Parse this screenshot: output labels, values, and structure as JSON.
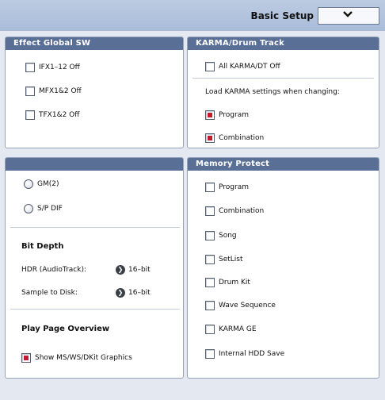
{
  "header": {
    "title": "Basic Setup",
    "dropdown_glyph": "❯"
  },
  "effect_global": {
    "title": "Effect Global SW",
    "items": [
      {
        "label": "IFX1–12 Off",
        "checked": false
      },
      {
        "label": "MFX1&2 Off",
        "checked": false
      },
      {
        "label": "TFX1&2 Off",
        "checked": false
      }
    ]
  },
  "karma": {
    "title": "KARMA/Drum Track",
    "all_off": {
      "label": "All KARMA/DT Off",
      "checked": false
    },
    "load_text": "Load KARMA settings when changing:",
    "items": [
      {
        "label": "Program",
        "checked": true
      },
      {
        "label": "Combination",
        "checked": true
      }
    ]
  },
  "audio": {
    "radios": [
      {
        "label": "GM(2)"
      },
      {
        "label": "S/P DIF"
      }
    ],
    "bit_depth_title": "Bit Depth",
    "hdr_label": "HDR (AudioTrack):",
    "hdr_value": "16–bit",
    "sample_label": "Sample to Disk:",
    "sample_value": "16–bit",
    "play_page_title": "Play Page Overview",
    "show_graphics": {
      "label": "Show MS/WS/DKit Graphics",
      "checked": true
    }
  },
  "memory_protect": {
    "title": "Memory Protect",
    "items": [
      {
        "label": "Program",
        "checked": false
      },
      {
        "label": "Combination",
        "checked": false
      },
      {
        "label": "Song",
        "checked": false
      },
      {
        "label": "SetList",
        "checked": false
      },
      {
        "label": "Drum Kit",
        "checked": false
      },
      {
        "label": "Wave Sequence",
        "checked": false
      },
      {
        "label": "KARMA GE",
        "checked": false
      },
      {
        "label": "Internal HDD Save",
        "checked": false
      }
    ]
  },
  "colors": {
    "header_bar": "#596f96",
    "checked_mark": "#c41a2a",
    "background": "#e4e9f1"
  }
}
